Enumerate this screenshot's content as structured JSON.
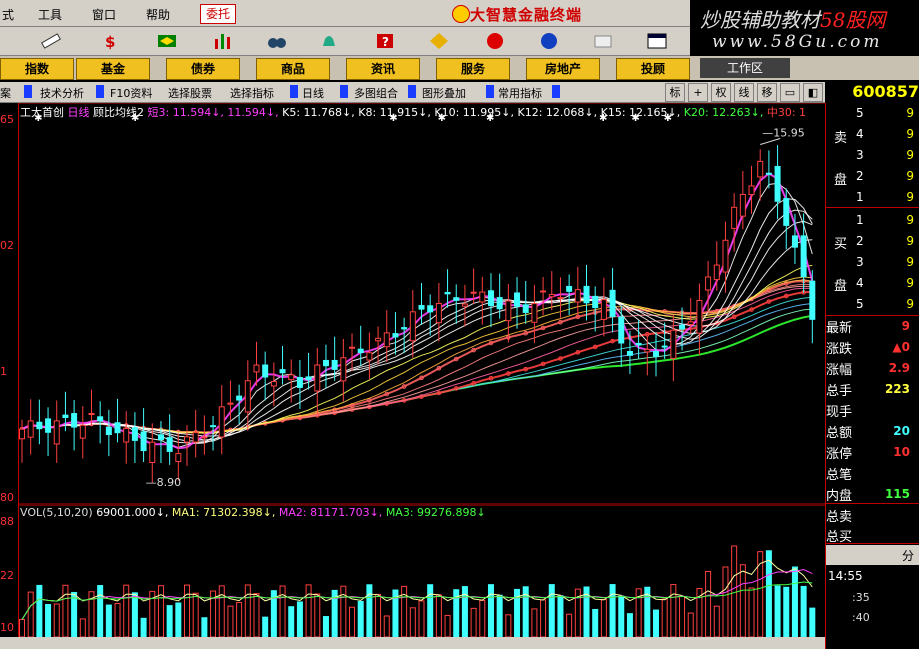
{
  "menu": {
    "items": [
      "式",
      "工具",
      "窗口",
      "帮助"
    ],
    "entrust": "委托"
  },
  "app_title": "大智慧金融终端",
  "watermark": {
    "line1_a": "炒股辅助教材",
    "line1_b": "58股网",
    "line2": "www.58Gu.com"
  },
  "categories": [
    "指数",
    "基金",
    "债券",
    "商品",
    "资讯",
    "服务",
    "房地产",
    "投顾"
  ],
  "workzone": "工作区",
  "subbar": {
    "items": [
      "案",
      "技术分析",
      "F10资料",
      "选择股票",
      "选择指标",
      "日线",
      "多图组合",
      "图形叠加",
      "常用指标"
    ],
    "right_buttons": [
      "标",
      "+",
      "权",
      "线",
      "移",
      "",
      ""
    ]
  },
  "stock_code": "600857",
  "chart_title": {
    "name": "工大首创",
    "period": "日线",
    "indicator": "顾比均线2"
  },
  "ma_legend": [
    {
      "label": "短3:",
      "value": "11.594",
      "color": "#ff40ff",
      "arrow": "↓"
    },
    {
      "label": "",
      "value": "11.594",
      "color": "#ff40ff",
      "arrow": "↓"
    },
    {
      "label": "K5:",
      "value": "11.768",
      "color": "#ffffff",
      "arrow": "↓"
    },
    {
      "label": "K8:",
      "value": "11.915",
      "color": "#ffffff",
      "arrow": "↓"
    },
    {
      "label": "K10:",
      "value": "11.995",
      "color": "#ffffff",
      "arrow": "↓"
    },
    {
      "label": "K12:",
      "value": "12.068",
      "color": "#ffffff",
      "arrow": "↓"
    },
    {
      "label": "K15:",
      "value": "12.165",
      "color": "#ffffff",
      "arrow": "↓"
    },
    {
      "label": "K20:",
      "value": "12.263",
      "color": "#40ff40",
      "arrow": "↓"
    },
    {
      "label": "中30:",
      "value": "1",
      "color": "#ff4040",
      "arrow": ""
    }
  ],
  "y_labels": [
    "65",
    "02",
    "1",
    "80",
    "88",
    "22",
    "10"
  ],
  "annotations": {
    "high": "15.95",
    "low": "8.90"
  },
  "vol_legend": {
    "vol": "VOL(5,10,20)",
    "vol_value": "69001.000",
    "ma1_label": "MA1:",
    "ma1": "71302.398",
    "ma2_label": "MA2:",
    "ma2": "81171.703",
    "ma3_label": "MA3:",
    "ma3": "99276.898"
  },
  "orderbook": {
    "sell_label": [
      "卖",
      "盘"
    ],
    "buy_label": [
      "买",
      "盘"
    ],
    "sell": [
      {
        "n": "5",
        "v": "9"
      },
      {
        "n": "4",
        "v": "9"
      },
      {
        "n": "3",
        "v": "9"
      },
      {
        "n": "2",
        "v": "9"
      },
      {
        "n": "1",
        "v": "9"
      }
    ],
    "buy": [
      {
        "n": "1",
        "v": "9"
      },
      {
        "n": "2",
        "v": "9"
      },
      {
        "n": "3",
        "v": "9"
      },
      {
        "n": "4",
        "v": "9"
      },
      {
        "n": "5",
        "v": "9"
      }
    ]
  },
  "quote": [
    {
      "label": "最新",
      "value": "9",
      "color": "#ff3030"
    },
    {
      "label": "涨跌",
      "value": "▲0",
      "color": "#ff3030"
    },
    {
      "label": "涨幅",
      "value": "2.9",
      "color": "#ff3030"
    },
    {
      "label": "总手",
      "value": "223",
      "color": "#ffff40"
    },
    {
      "label": "现手",
      "value": "",
      "color": "#ffff40"
    },
    {
      "label": "总额",
      "value": "20",
      "color": "#40ffff"
    },
    {
      "label": "涨停",
      "value": "10",
      "color": "#ff3030"
    },
    {
      "label": "总笔",
      "value": "",
      "color": "#ffff40"
    },
    {
      "label": "内盘",
      "value": "115",
      "color": "#40ff40"
    }
  ],
  "bottom": {
    "total_sell": "总卖",
    "total_buy": "总买",
    "split": "分",
    "time": "14:55",
    "t1": ":35",
    "t2": ":40"
  },
  "colors": {
    "bg": "#000000",
    "grid": "#c00000",
    "up": "#ff4040",
    "down": "#40ffff"
  }
}
